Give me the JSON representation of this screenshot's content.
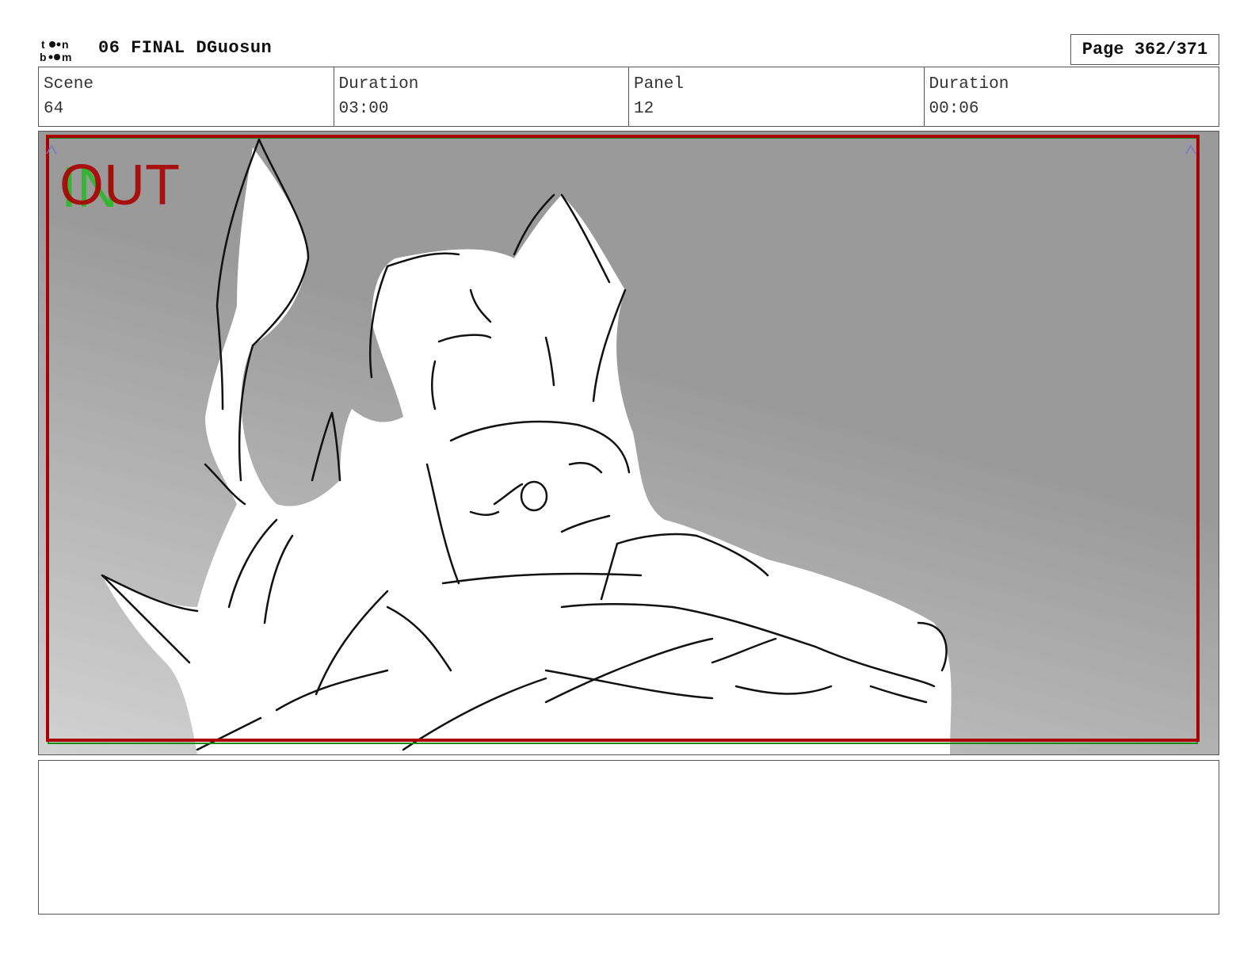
{
  "header": {
    "logo_text": "toon boom",
    "title": "06 FINAL DGuosun",
    "page": "Page 362/371"
  },
  "info": [
    {
      "label": "Scene",
      "value": "64"
    },
    {
      "label": "Duration",
      "value": "03:00"
    },
    {
      "label": "Panel",
      "value": "12"
    },
    {
      "label": "Duration",
      "value": "00:06"
    }
  ],
  "panel": {
    "in_label": "IN",
    "out_label": "OUT",
    "in_color": "#22bb22",
    "out_color": "#aa0000",
    "background_color": "#9a9a9a"
  },
  "notes": {
    "text": ""
  }
}
